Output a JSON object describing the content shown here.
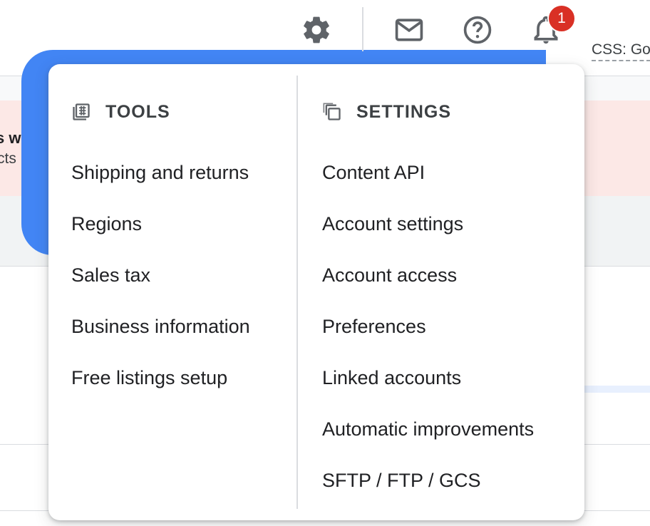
{
  "toolbar": {
    "icons": [
      "gear-icon",
      "mail-icon",
      "help-icon",
      "bell-icon"
    ],
    "notification_count": "1",
    "account_label": "CSS: Go"
  },
  "background": {
    "alert_title": "s w",
    "alert_text": "cts"
  },
  "menu": {
    "tools": {
      "title": "TOOLS",
      "icon": "tools-icon",
      "items": [
        {
          "label": "Shipping and returns"
        },
        {
          "label": "Regions"
        },
        {
          "label": "Sales tax"
        },
        {
          "label": "Business information"
        },
        {
          "label": "Free listings setup"
        }
      ]
    },
    "settings": {
      "title": "SETTINGS",
      "icon": "settings-copy-icon",
      "items": [
        {
          "label": "Content API"
        },
        {
          "label": "Account settings"
        },
        {
          "label": "Account access"
        },
        {
          "label": "Preferences"
        },
        {
          "label": "Linked accounts"
        },
        {
          "label": "Automatic improvements"
        },
        {
          "label": "SFTP / FTP / GCS"
        }
      ]
    }
  },
  "colors": {
    "accent_blue": "#4285f4",
    "badge_red": "#d93025",
    "alert_bg": "#fce8e6",
    "text_primary": "#202124",
    "icon_grey": "#5f6368"
  }
}
